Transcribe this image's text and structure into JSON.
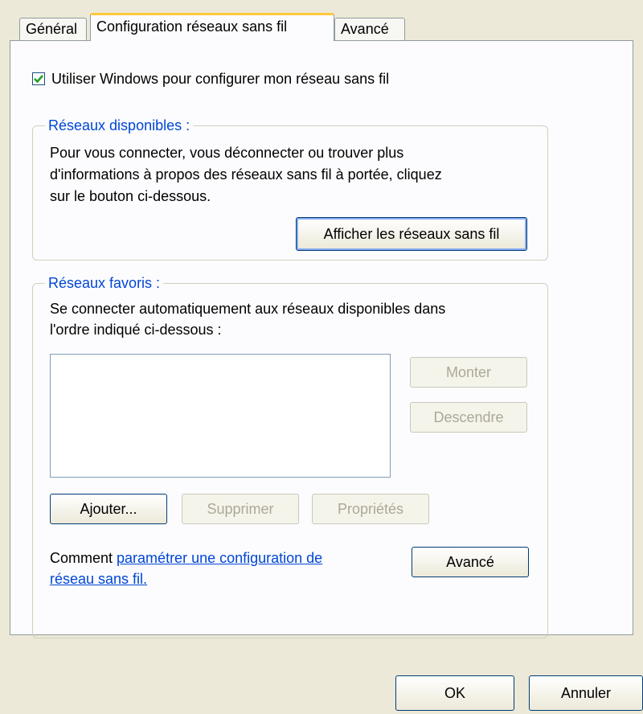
{
  "tabs": [
    {
      "label": "Général"
    },
    {
      "label": "Configuration réseaux sans fil"
    },
    {
      "label": "Avancé"
    }
  ],
  "use_windows": {
    "checked": true,
    "label": "Utiliser Windows pour configurer mon réseau sans fil"
  },
  "available": {
    "title": "Réseaux disponibles :",
    "description_lines": [
      "Pour vous connecter, vous déconnecter ou trouver plus",
      "d'informations à propos des réseaux sans fil à portée, cliquez",
      "sur le bouton ci-dessous."
    ],
    "button": "Afficher les réseaux sans fil"
  },
  "favorites": {
    "title": "Réseaux favoris :",
    "description_lines": [
      "Se connecter automatiquement aux réseaux disponibles dans",
      "l'ordre indiqué ci-dessous :"
    ],
    "move_up": "Monter",
    "move_down": "Descendre",
    "add": "Ajouter...",
    "remove": "Supprimer",
    "properties": "Propriétés"
  },
  "help": {
    "prefix": "Comment ",
    "link_line1": "paramétrer une configuration de",
    "link_line2": "réseau sans fil."
  },
  "advanced_button": "Avancé",
  "footer": {
    "ok": "OK",
    "cancel": "Annuler"
  }
}
